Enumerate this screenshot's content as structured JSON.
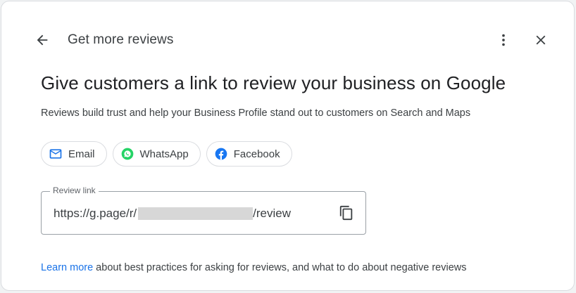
{
  "header": {
    "title": "Get more reviews",
    "back_icon": "arrow-back-icon",
    "more_icon": "more-vert-icon",
    "close_icon": "close-icon"
  },
  "main": {
    "heading": "Give customers a link to review your business on Google",
    "subtext": "Reviews build trust and help your Business Profile stand out to customers on Search and Maps"
  },
  "share_options": [
    {
      "label": "Email",
      "icon": "email-icon",
      "color": "#1a73e8"
    },
    {
      "label": "WhatsApp",
      "icon": "whatsapp-icon",
      "color": "#25d366"
    },
    {
      "label": "Facebook",
      "icon": "facebook-icon",
      "color": "#1877f2"
    }
  ],
  "review_link": {
    "legend": "Review link",
    "prefix": "https://g.page/r/",
    "suffix": "/review",
    "copy_icon": "copy-icon"
  },
  "footer": {
    "link_text": "Learn more",
    "rest_text": " about best practices for asking for reviews, and what to do about negative reviews"
  },
  "colors": {
    "accent": "#1a73e8",
    "text_primary": "#202124",
    "text_secondary": "#3c4043",
    "border": "#dadce0"
  }
}
